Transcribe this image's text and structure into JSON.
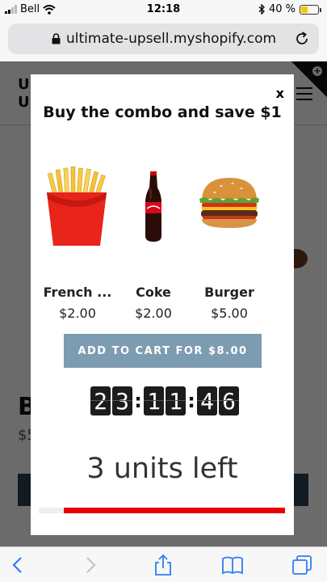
{
  "status_bar": {
    "carrier": "Bell",
    "time": "12:18",
    "battery": "40 %",
    "battery_level": 0.4
  },
  "browser": {
    "url": "ultimate-upsell.myshopify.com"
  },
  "modal": {
    "close_label": "x",
    "title": "Buy the combo and save $1",
    "products": [
      {
        "name": "French ...",
        "price": "$2.00"
      },
      {
        "name": "Coke",
        "price": "$2.00"
      },
      {
        "name": "Burger",
        "price": "$5.00"
      }
    ],
    "cta_label": "ADD TO CART FOR $8.00",
    "timer": {
      "hours": "23",
      "minutes": "11",
      "seconds": "46"
    },
    "units_left": "3 units left",
    "stock_level": 0.9
  },
  "background_page": {
    "logo_line1": "U",
    "logo_line2": "U",
    "product_title": "B",
    "product_price": "$5"
  },
  "colors": {
    "cta": "#7c9cb2",
    "stock_bar": "#e60000",
    "ios_blue": "#2f7cf6"
  }
}
